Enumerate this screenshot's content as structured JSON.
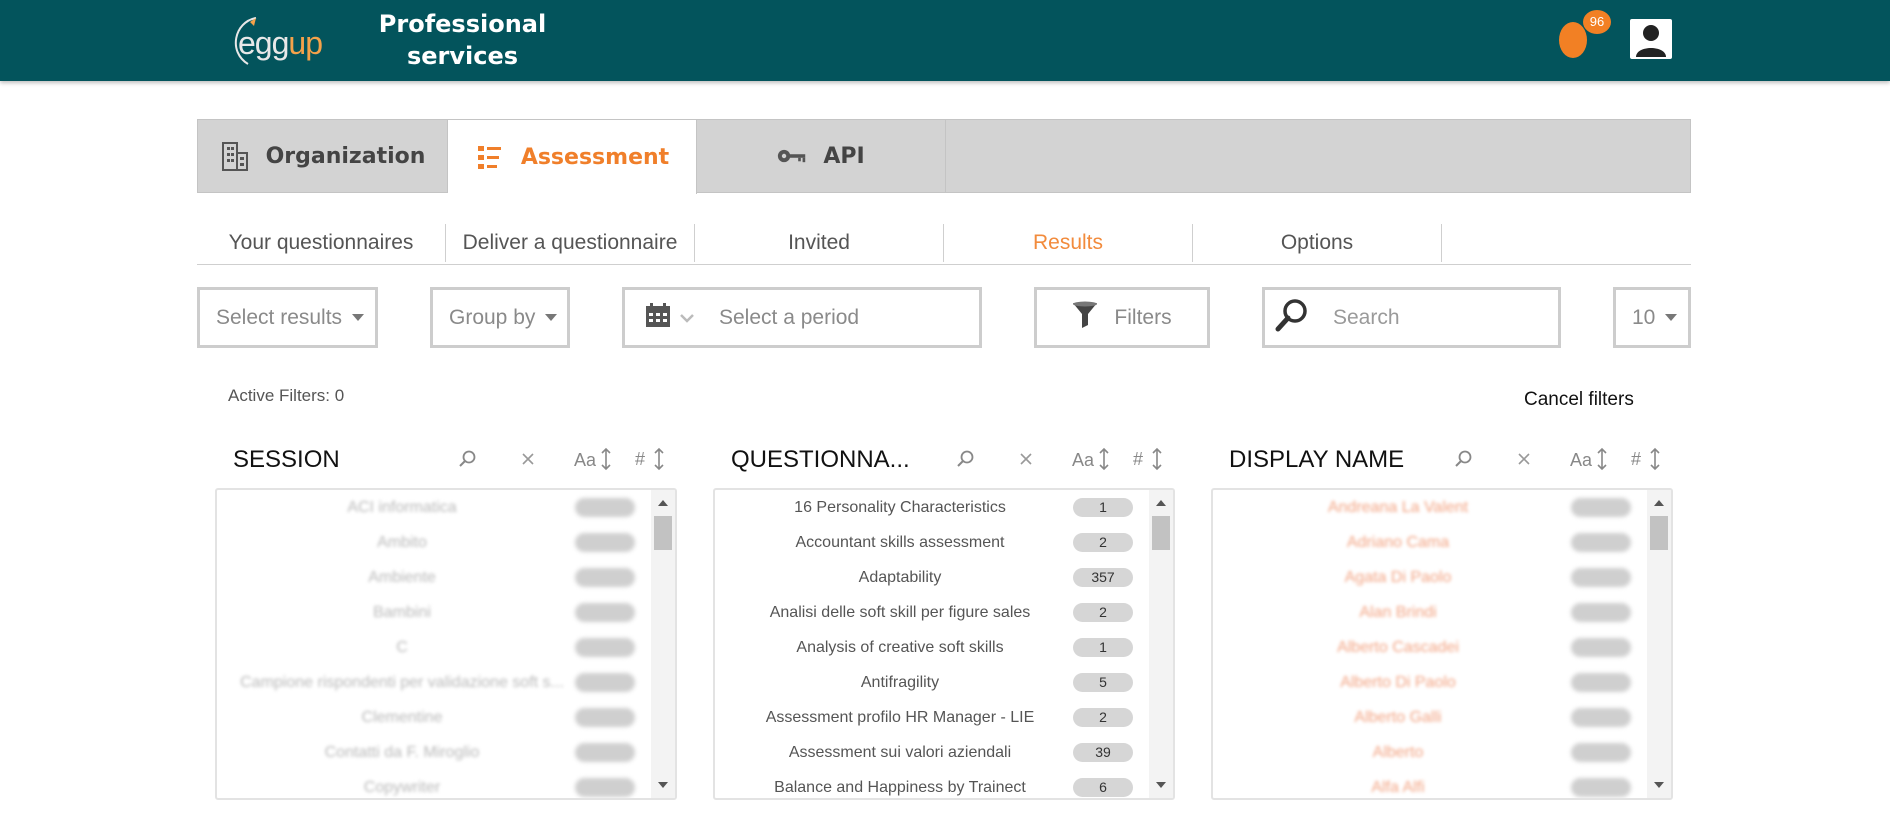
{
  "header": {
    "logo_main": "egg",
    "logo_accent": "up",
    "title_line1": "Professional",
    "title_line2": "services",
    "notification_count": "96"
  },
  "main_tabs": [
    {
      "label": "Organization",
      "icon": "building-icon",
      "active": false
    },
    {
      "label": "Assessment",
      "icon": "list-icon",
      "active": true
    },
    {
      "label": "API",
      "icon": "key-icon",
      "active": false
    }
  ],
  "sub_tabs": [
    {
      "label": "Your questionnaires",
      "active": false
    },
    {
      "label": "Deliver a questionnaire",
      "active": false
    },
    {
      "label": "Invited",
      "active": false
    },
    {
      "label": "Results",
      "active": true
    },
    {
      "label": "Options",
      "active": false
    }
  ],
  "filters": {
    "select_results": "Select results",
    "group_by": "Group by",
    "period_placeholder": "Select a period",
    "filters_label": "Filters",
    "search_placeholder": "Search",
    "page_size": "10",
    "active_filters": "Active Filters: 0",
    "cancel_filters": "Cancel filters"
  },
  "panels": {
    "session": {
      "title": "SESSION",
      "rows": [
        {
          "label": "ACI informatica",
          "count": "—"
        },
        {
          "label": "Ambito",
          "count": "—"
        },
        {
          "label": "Ambiente",
          "count": "—"
        },
        {
          "label": "Bambini",
          "count": "—"
        },
        {
          "label": "C",
          "count": "—"
        },
        {
          "label": "Campione rispondenti per validazione soft s...",
          "count": "—"
        },
        {
          "label": "Clementine",
          "count": "—"
        },
        {
          "label": "Contatti da F. Miroglio",
          "count": "—"
        },
        {
          "label": "Copywriter",
          "count": "—"
        }
      ]
    },
    "questionnaire": {
      "title": "QUESTIONNA...",
      "rows": [
        {
          "label": "16 Personality Characteristics",
          "count": "1"
        },
        {
          "label": "Accountant skills assessment",
          "count": "2"
        },
        {
          "label": "Adaptability",
          "count": "357"
        },
        {
          "label": "Analisi delle soft skill per figure sales",
          "count": "2"
        },
        {
          "label": "Analysis of creative soft skills",
          "count": "1"
        },
        {
          "label": "Antifragility",
          "count": "5"
        },
        {
          "label": "Assessment profilo HR Manager - LIE",
          "count": "2"
        },
        {
          "label": "Assessment sui valori aziendali",
          "count": "39"
        },
        {
          "label": "Balance and Happiness by Trainect",
          "count": "6"
        }
      ]
    },
    "display_name": {
      "title": "DISPLAY NAME",
      "rows": [
        {
          "label": "Andreana La Valent",
          "count": "—"
        },
        {
          "label": "Adriano Cama",
          "count": "—"
        },
        {
          "label": "Agata Di Paolo",
          "count": "—"
        },
        {
          "label": "Alan Brindi",
          "count": "—"
        },
        {
          "label": "Alberto Cascadei",
          "count": "—"
        },
        {
          "label": "Alberto Di Paolo",
          "count": "—"
        },
        {
          "label": "Alberto Galli",
          "count": "—"
        },
        {
          "label": "Alberto",
          "count": "—"
        },
        {
          "label": "Alfa Alfi",
          "count": "—"
        }
      ]
    }
  },
  "colors": {
    "header_bg": "#03545c",
    "accent": "#f07f2a",
    "tab_bg": "#d3d3d3"
  }
}
